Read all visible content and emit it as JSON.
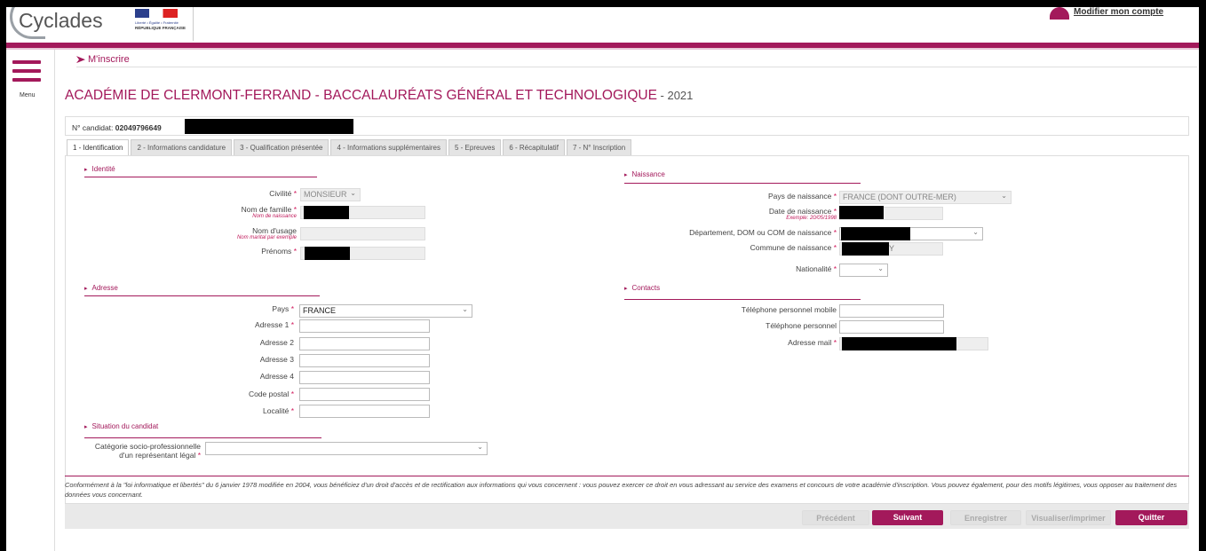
{
  "header": {
    "app_name": "Cyclades",
    "rf_motto": "Liberté • Égalité • Fraternité",
    "rf_name": "RÉPUBLIQUE FRANÇAISE",
    "account_link": "Modifier mon compte"
  },
  "menu": {
    "label": "Menu"
  },
  "breadcrumb": {
    "label": "M'inscrire"
  },
  "title": {
    "main": "ACADÉMIE DE CLERMONT-FERRAND - BACCALAURÉATS GÉNÉRAL ET TECHNOLOGIQUE",
    "year": " - 2021"
  },
  "candidate": {
    "label": "N° candidat:",
    "number": "02049796649"
  },
  "tabs": [
    "1 - Identification",
    "2 - Informations candidature",
    "3 - Qualification présentée",
    "4 - Informations supplémentaires",
    "5 - Epreuves",
    "6 - Récapitulatif",
    "7 - N° Inscription"
  ],
  "identity": {
    "section": "Identité",
    "civilite_label": "Civilité",
    "civilite_value": "MONSIEUR",
    "nom_famille_label": "Nom de famille",
    "nom_famille_hint": "Nom de naissance",
    "nom_usage_label": "Nom d'usage",
    "nom_usage_hint": "Nom marital par exemple",
    "prenoms_label": "Prénoms"
  },
  "birth": {
    "section": "Naissance",
    "pays_label": "Pays de naissance",
    "pays_value": "FRANCE (DONT OUTRE-MER)",
    "date_label": "Date de naissance",
    "date_hint": "Exemple: 20/05/1998",
    "dept_label": "Département, DOM ou COM de naissance",
    "commune_label": "Commune de naissance",
    "commune_value": "Y",
    "nationalite_label": "Nationalité"
  },
  "address": {
    "section": "Adresse",
    "pays_label": "Pays",
    "pays_value": "FRANCE",
    "adresse1_label": "Adresse 1",
    "adresse2_label": "Adresse 2",
    "adresse3_label": "Adresse 3",
    "adresse4_label": "Adresse 4",
    "code_postal_label": "Code postal",
    "localite_label": "Localité"
  },
  "contacts": {
    "section": "Contacts",
    "tel_mobile_label": "Téléphone personnel mobile",
    "tel_label": "Téléphone personnel",
    "mail_label": "Adresse mail"
  },
  "situation": {
    "section": "Situation du candidat",
    "csp_label_line1": "Catégorie socio-professionnelle",
    "csp_label_line2": "d'un représentant légal"
  },
  "required_mark": "*",
  "legal_text": "Conformément à la \"loi informatique et libertés\" du 6 janvier 1978 modifiée en 2004, vous bénéficiez d'un droit d'accès et de rectification aux informations qui vous concernent : vous pouvez exercer ce droit en vous adressant au service des examens et concours de votre académie d'inscription. Vous pouvez également, pour des motifs légitimes, vous opposer au traitement des données vous concernant.",
  "buttons": {
    "previous": "Précédent",
    "next": "Suivant",
    "save": "Enregistrer",
    "print": "Visualiser/imprimer",
    "quit": "Quitter"
  },
  "colors": {
    "accent": "#a3195b"
  }
}
